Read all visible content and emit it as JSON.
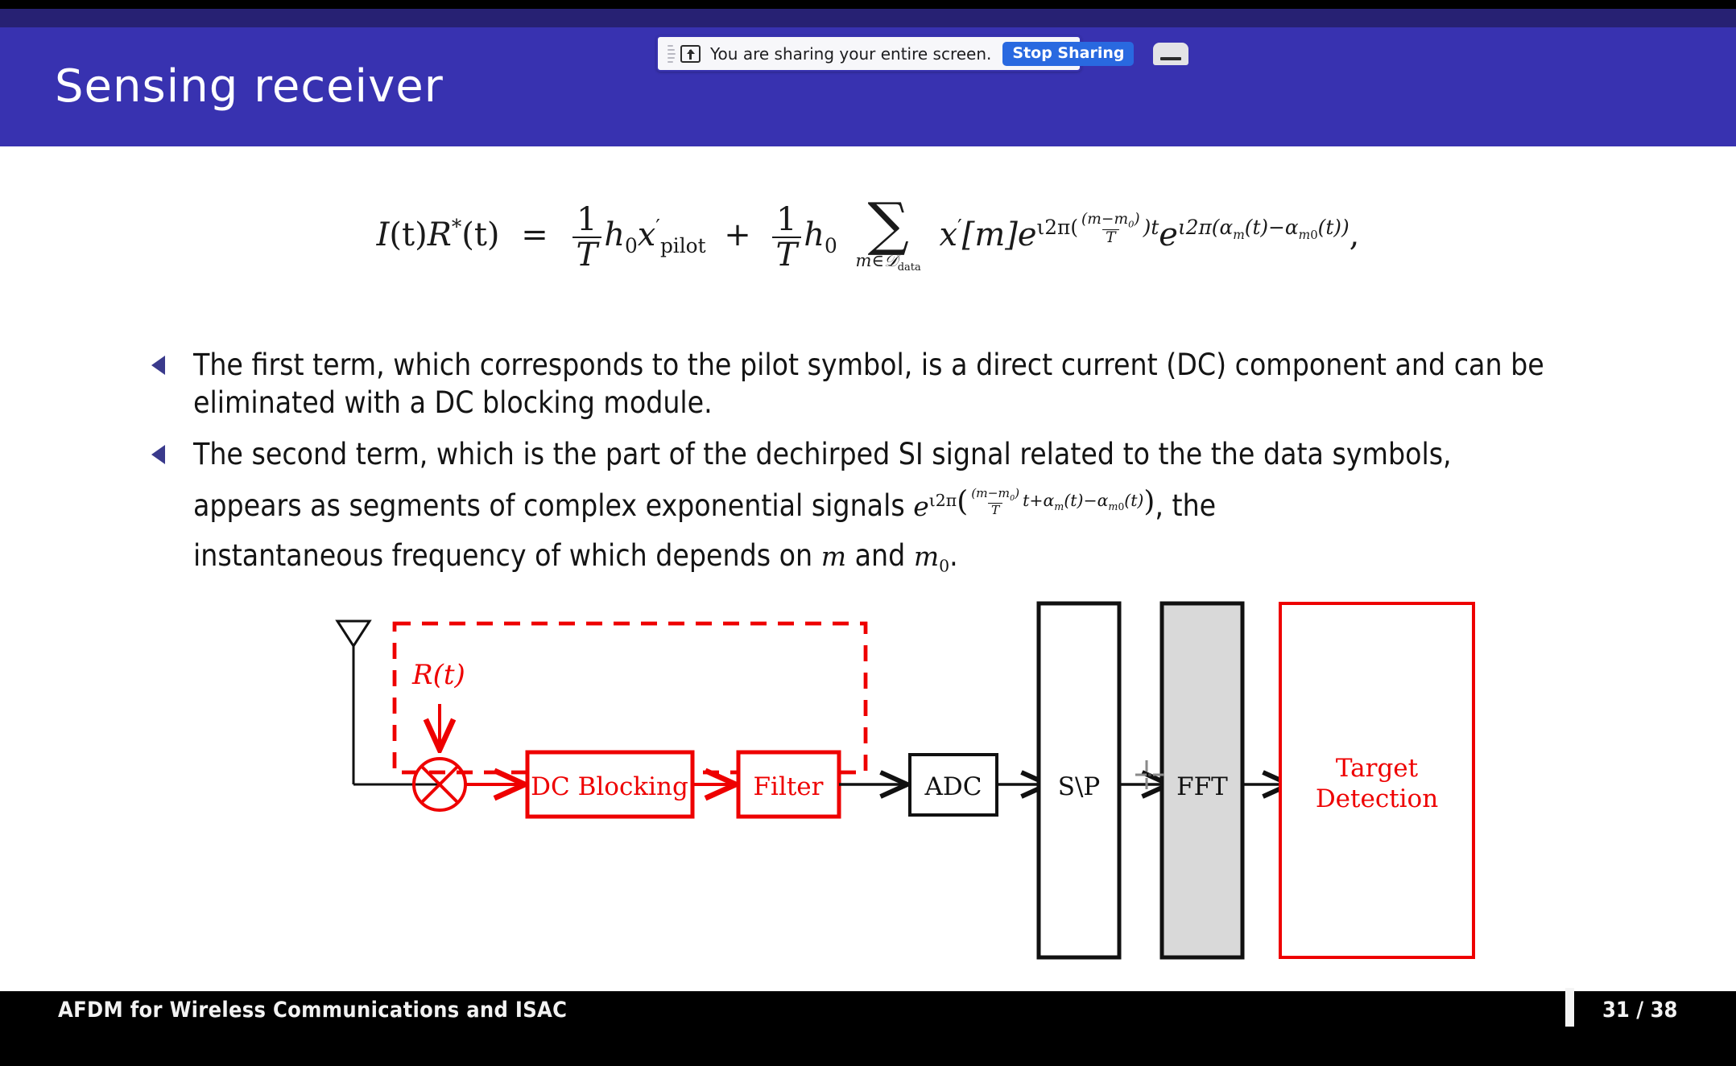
{
  "colors": {
    "header_blue": "#3832b0",
    "header_dark_blue": "#272173",
    "top_black": "#000000",
    "bullet_marker": "#3a3a8c",
    "diagram_red": "#ee0000",
    "diagram_black": "#111111",
    "fft_fill": "#d9d9d9",
    "share_button_blue": "#2969e0",
    "footer_black": "#000000",
    "footer_text": "#f2f2f2"
  },
  "share_bar": {
    "icon": "share-screen-icon",
    "message": "You are sharing your entire screen.",
    "stop_label": "Stop Sharing",
    "minimize_icon": "minimize-icon",
    "grip_icon": "drag-grip-icon"
  },
  "header": {
    "title": "Sensing receiver"
  },
  "equation": {
    "lhs_I": "I",
    "lhs_t": "(t)",
    "lhs_R": "R",
    "lhs_star": "*",
    "lhs_t2": "(t)",
    "equals": "=",
    "frac1_num": "1",
    "frac1_den": "T",
    "h0": "h",
    "h0_sub": "0",
    "xprime": "x",
    "xprime_mark": "′",
    "pilot_sub": "pilot",
    "plus": "+",
    "frac2_num": "1",
    "frac2_den": "T",
    "sum_symbol": "∑",
    "sum_limit": "m∈𝒟",
    "sum_limit_sub": "data",
    "xm": "x",
    "xm_mark": "′",
    "xm_bracket": "[m]",
    "exp1_e": "e",
    "exp1_head": "ι2π(",
    "exp1_num": "(m−m",
    "exp1_num_sub": "0",
    "exp1_num_close": ")",
    "exp1_den": "T",
    "exp1_tail": ")t",
    "exp2_e": "e",
    "exp2_body": "ι2π(α",
    "exp2_sub1": "m",
    "exp2_mid": "(t)−α",
    "exp2_sub2": "m",
    "exp2_sub2_sub": "0",
    "exp2_tail": "(t))",
    "comma": ","
  },
  "bullets": [
    {
      "marker": "left-triangle-bullet",
      "text": "The first term, which corresponds to the pilot symbol, is a direct current (DC) component and can be eliminated with a DC blocking module."
    },
    {
      "marker": "left-triangle-bullet",
      "line1": "The second term, which is the part of the dechirped SI signal related to the the data symbols,",
      "line2_pre": "appears as segments of complex exponential signals",
      "line2_post": ", the",
      "line3_pre": "instantaneous frequency of which depends on",
      "line3_m": "m",
      "line3_and": "and",
      "line3_m0": "m",
      "line3_m0_sub": "0",
      "line3_period": ".",
      "inline_eq": {
        "e": "e",
        "head": "ι2π",
        "num": "(m−m",
        "num_sub": "0",
        "num_close": ")",
        "den": "T",
        "mid": "t+α",
        "sub1": "m",
        "mid2": "(t)−α",
        "sub2": "m",
        "sub2_sub": "0",
        "tail": "(t)"
      }
    }
  ],
  "diagram": {
    "name": "sensing-receiver-block-diagram",
    "antenna_label": "antenna-icon",
    "rt_label": "R(t)",
    "mixer_label": "mixer-icon",
    "dashed_group_label": "analog-frontend-dashed-group",
    "blocks": [
      {
        "id": "dc-blocking",
        "label": "DC Blocking",
        "style": "red-box"
      },
      {
        "id": "filter",
        "label": "Filter",
        "style": "red-box"
      },
      {
        "id": "adc",
        "label": "ADC",
        "style": "black-box"
      },
      {
        "id": "s-p",
        "label": "S\\P",
        "style": "black-tall-box"
      },
      {
        "id": "fft",
        "label": "FFT",
        "style": "gray-tall-box"
      },
      {
        "id": "target-detection",
        "label_line1": "Target",
        "label_line2": "Detection",
        "style": "red-tall-box"
      }
    ],
    "cursor": "crosshair-cursor"
  },
  "footer": {
    "title": "AFDM for Wireless Communications and ISAC",
    "page": "31 / 38"
  }
}
